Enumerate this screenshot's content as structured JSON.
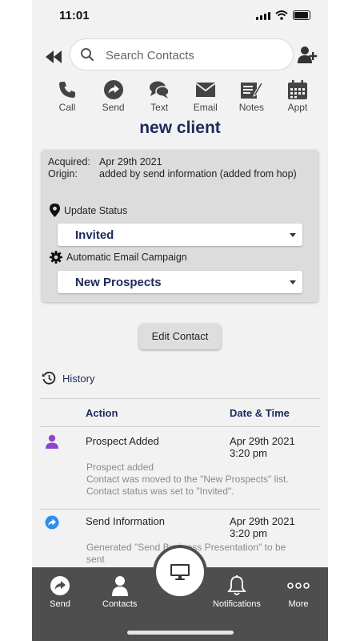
{
  "status_bar": {
    "time": "11:01"
  },
  "search": {
    "placeholder": "Search Contacts"
  },
  "actions": [
    {
      "label": "Call",
      "icon": "phone-icon"
    },
    {
      "label": "Send",
      "icon": "send-icon"
    },
    {
      "label": "Text",
      "icon": "chat-icon"
    },
    {
      "label": "Email",
      "icon": "email-icon"
    },
    {
      "label": "Notes",
      "icon": "notes-icon"
    },
    {
      "label": "Appt",
      "icon": "calendar-icon"
    }
  ],
  "contact": {
    "name": "new client",
    "acquired_label": "Acquired:",
    "acquired_value": "Apr 29th 2021",
    "origin_label": "Origin:",
    "origin_value": "added by send information (added from hop)"
  },
  "status": {
    "label": "Update Status",
    "value": "Invited"
  },
  "campaign": {
    "label": "Automatic Email Campaign",
    "value": "New Prospects"
  },
  "edit_button": "Edit Contact",
  "history": {
    "title": "History",
    "col_action": "Action",
    "col_datetime": "Date & Time",
    "entries": [
      {
        "action": "Prospect Added",
        "date": "Apr 29th 2021",
        "time": "3:20 pm",
        "details": [
          "Prospect added",
          "Contact was moved to the \"New Prospects\" list.",
          "Contact status was set to \"Invited\"."
        ],
        "icon": "person-icon",
        "icon_color": "#8e44d0"
      },
      {
        "action": "Send Information",
        "date": "Apr 29th 2021",
        "time": "3:20 pm",
        "details": [
          "Generated \"Send Business Presentation\" to be",
          "sent"
        ],
        "icon": "send-circle-icon",
        "icon_color": "#2d8ef0"
      }
    ]
  },
  "bottom_nav": {
    "send": "Send",
    "contacts": "Contacts",
    "notifications": "Notifications",
    "more": "More"
  },
  "colors": {
    "accent": "#1c2a5c",
    "nav_bg": "#4e4e4e",
    "card_bg": "#dcdcdc"
  }
}
